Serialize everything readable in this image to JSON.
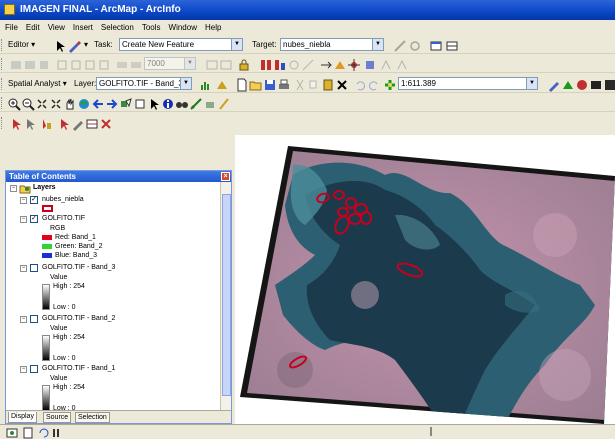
{
  "window": {
    "title": "IMAGEN FINAL - ArcMap - ArcInfo"
  },
  "menu": [
    "File",
    "Edit",
    "View",
    "Insert",
    "Selection",
    "Tools",
    "Window",
    "Help"
  ],
  "editor_toolbar": {
    "editor_label": "Editor ▾",
    "task_label": "Task:",
    "task_value": "Create New Feature",
    "target_label": "Target:",
    "target_value": "nubes_niebla"
  },
  "georef_toolbar": {
    "scale_value": "7000"
  },
  "spatial_toolbar": {
    "spatial_analyst_label": "Spatial Analyst ▾",
    "layer_label": "Layer:",
    "layer_value": "GOLFITO.TIF - Band_3",
    "scale_value": "1:611.389"
  },
  "toc": {
    "title": "Table of Contents",
    "root": "Layers",
    "layers": [
      {
        "name": "nubes_niebla"
      },
      {
        "name": "GOLFITO.TIF",
        "rgb": "RGB",
        "bands": [
          "Red:   Band_1",
          "Green: Band_2",
          "Blue:   Band_3"
        ],
        "band_colors": [
          "#e2001a",
          "#2fd52f",
          "#1a2fd6"
        ]
      },
      {
        "name": "GOLFITO.TIF - Band_3",
        "value": "Value",
        "high": "High : 254",
        "low": "Low : 0"
      },
      {
        "name": "GOLFITO.TIF - Band_2",
        "value": "Value",
        "high": "High : 254",
        "low": "Low : 0"
      },
      {
        "name": "GOLFITO.TIF - Band_1",
        "value": "Value",
        "high": "High : 254",
        "low": "Low : 0"
      }
    ],
    "tabs": [
      "Display",
      "Source",
      "Selection"
    ]
  },
  "colors": {
    "title_bar": "#0a46c8",
    "polygon_outline": "#c8001e",
    "water": "#1d3f52",
    "land": "#b48aa0"
  }
}
